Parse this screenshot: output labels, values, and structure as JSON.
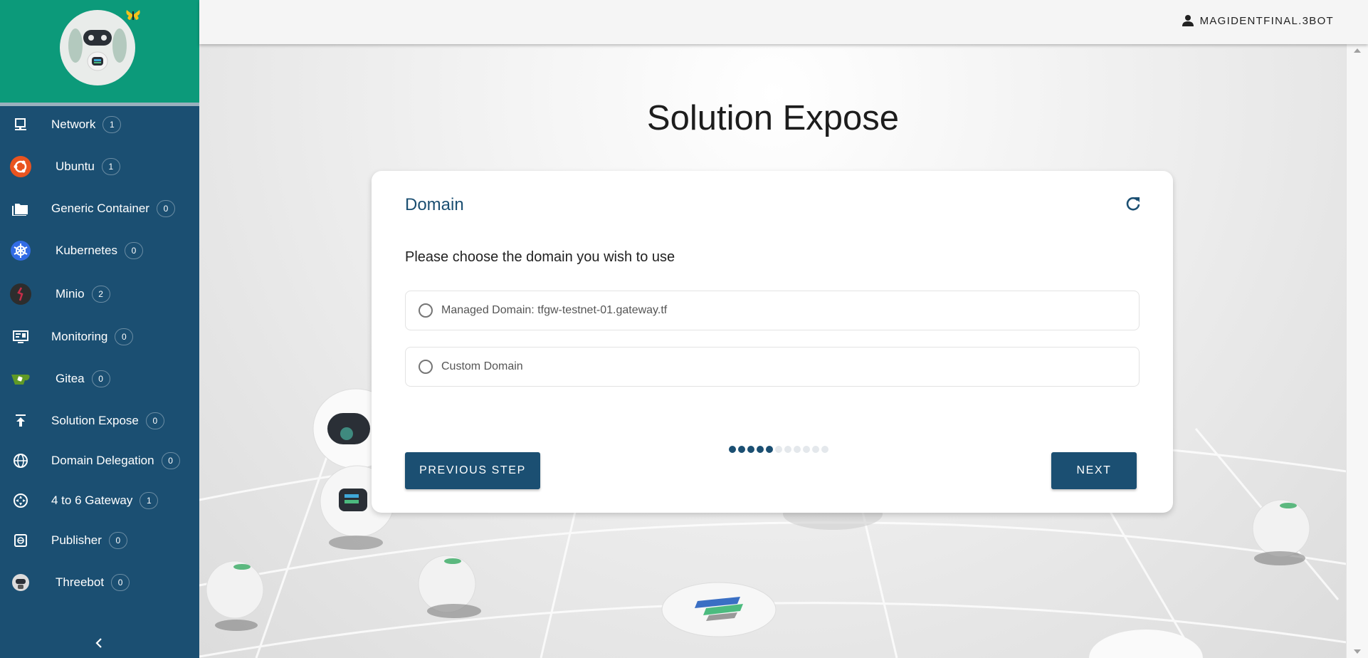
{
  "user": {
    "name": "MAGIDENTFINAL.3BOT",
    "icon": "person-icon"
  },
  "sidebar": {
    "items": [
      {
        "label": "Network",
        "count": "1",
        "icon": "network-icon",
        "color": "#ffffff"
      },
      {
        "label": "Ubuntu",
        "count": "1",
        "icon": "ubuntu-icon",
        "color": "#e95420"
      },
      {
        "label": "Generic Container",
        "count": "0",
        "icon": "folder-icon",
        "color": "#ffffff"
      },
      {
        "label": "Kubernetes",
        "count": "0",
        "icon": "kubernetes-icon",
        "color": "#326ce5"
      },
      {
        "label": "Minio",
        "count": "2",
        "icon": "minio-icon",
        "color": "#c72e49"
      },
      {
        "label": "Monitoring",
        "count": "0",
        "icon": "monitor-icon",
        "color": "#ffffff"
      },
      {
        "label": "Gitea",
        "count": "0",
        "icon": "gitea-icon",
        "color": "#609926"
      },
      {
        "label": "Solution Expose",
        "count": "0",
        "icon": "upload-icon",
        "color": "#ffffff"
      },
      {
        "label": "Domain Delegation",
        "count": "0",
        "icon": "globe-icon",
        "color": "#ffffff"
      },
      {
        "label": "4 to 6 Gateway",
        "count": "1",
        "icon": "gateway-icon",
        "color": "#ffffff"
      },
      {
        "label": "Publisher",
        "count": "0",
        "icon": "publisher-icon",
        "color": "#ffffff"
      },
      {
        "label": "Threebot",
        "count": "0",
        "icon": "threebot-icon",
        "color": "#ffffff"
      }
    ],
    "collapse_icon": "chevron-left-icon"
  },
  "main": {
    "title": "Solution Expose",
    "card": {
      "title": "Domain",
      "refresh_icon": "refresh-icon",
      "question": "Please choose the domain you wish to use",
      "options": [
        {
          "label": "Managed Domain: tfgw-testnet-01.gateway.tf",
          "selected": false
        },
        {
          "label": "Custom Domain",
          "selected": false
        }
      ],
      "steps": {
        "total": 11,
        "completed": 5
      },
      "previous_label": "PREVIOUS STEP",
      "next_label": "NEXT"
    }
  },
  "colors": {
    "sidebar": "#1b4f72",
    "logo_background": "#0c9a7a",
    "primary": "#1b4f72"
  }
}
